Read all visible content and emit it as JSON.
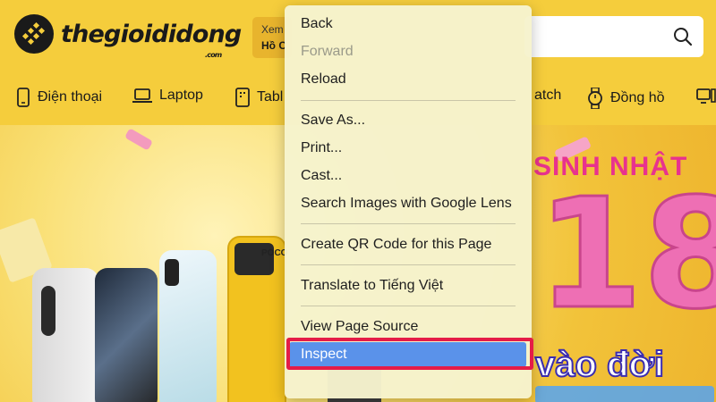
{
  "site": {
    "logo_text": "thegioididong",
    "logo_suffix": ".com",
    "location_prefix": "Xem",
    "location_city": "Hồ C",
    "search_icon": "search-icon",
    "nav": [
      {
        "label": "Điện thoại",
        "icon": "phone-icon"
      },
      {
        "label": "Laptop",
        "icon": "laptop-icon"
      },
      {
        "label": "Tabl",
        "icon": "tablet-icon"
      },
      {
        "label": "atch",
        "icon": "smartwatch-icon"
      },
      {
        "label": "Đồng hồ",
        "icon": "watch-icon"
      },
      {
        "label": "",
        "icon": "pc-icon"
      }
    ],
    "banner": {
      "headline": "SINH NHẬT",
      "big_number": "18",
      "tagline": "vào đời",
      "brand_on_phone": "POCO"
    },
    "colors": {
      "brand_yellow": "#f5cd3c",
      "banner_pink": "#ee6fb4"
    }
  },
  "context_menu": {
    "groups": [
      [
        {
          "label": "Back",
          "enabled": true
        },
        {
          "label": "Forward",
          "enabled": false
        },
        {
          "label": "Reload",
          "enabled": true
        }
      ],
      [
        {
          "label": "Save As...",
          "enabled": true
        },
        {
          "label": "Print...",
          "enabled": true
        },
        {
          "label": "Cast...",
          "enabled": true
        },
        {
          "label": "Search Images with Google Lens",
          "enabled": true
        }
      ],
      [
        {
          "label": "Create QR Code for this Page",
          "enabled": true
        }
      ],
      [
        {
          "label": "Translate to Tiếng Việt",
          "enabled": true
        }
      ],
      [
        {
          "label": "View Page Source",
          "enabled": true
        },
        {
          "label": "Inspect",
          "enabled": true,
          "highlighted": true
        }
      ]
    ],
    "highlight_color": "#5a92ea",
    "annotation_color": "#e51c47"
  }
}
